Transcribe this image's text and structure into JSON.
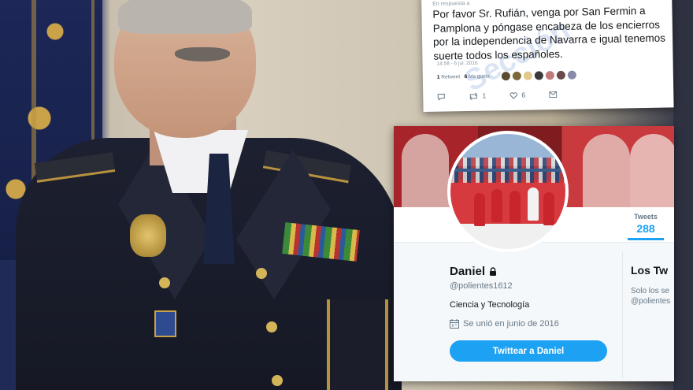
{
  "tweet": {
    "reply_to": "En respuesta a",
    "text": "Por favor Sr. Rufián, venga por San Fermin a Pamplona y póngase encabeza de los encierros por la independencia de Navarra e igual tenemos suerte todos los españoles.",
    "timestamp": "14:58 - 6 jul. 2016",
    "retweets_count": "1",
    "retweets_label": "Retweet",
    "likes_count": "6",
    "likes_label": "Me gusta",
    "retweet_action_count": "1",
    "like_action_count": "6",
    "watermark": "Sección"
  },
  "profile": {
    "display_name": "Daniel",
    "handle": "@polientes1612",
    "bio": "Ciencia y Tecnología",
    "joined": "Se unió en junio de 2016",
    "tweets_label": "Tweets",
    "tweets_count": "288",
    "tweet_to_button": "Twittear a Daniel",
    "side_title": "Los Tw",
    "side_text_line1": "Solo los se",
    "side_text_line2": "@polientes"
  },
  "colors": {
    "twitter_blue": "#1da1f2",
    "text_dark": "#14171a",
    "text_gray": "#657786",
    "banner_red": "#a8242b"
  },
  "icons": [
    "lock-icon",
    "calendar-icon",
    "reply-icon",
    "retweet-icon",
    "like-icon",
    "message-icon"
  ]
}
